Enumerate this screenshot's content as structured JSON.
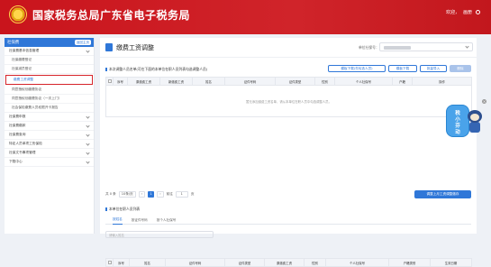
{
  "header": {
    "title": "国家税务总局广东省电子税务局",
    "welcome": "欢迎，",
    "user_name": "画册"
  },
  "sidebar": {
    "title": "社保费",
    "collapse_label": "返回主页",
    "items": [
      {
        "label": "社保费基本信息管理",
        "type": "group"
      },
      {
        "label": "社保缴费登记",
        "type": "sub"
      },
      {
        "label": "社保减员登记",
        "type": "sub"
      },
      {
        "label": "缴费工资调整",
        "type": "sub",
        "active": true
      },
      {
        "label": "同意授权划缴费协议",
        "type": "sub"
      },
      {
        "label": "同意授权划缴费协议（一次上门）",
        "type": "sub"
      },
      {
        "label": "社会保险缴费人员权限开卡报告",
        "type": "sub"
      },
      {
        "label": "社保费申报",
        "type": "group"
      },
      {
        "label": "社保费缴款",
        "type": "group"
      },
      {
        "label": "社保费查询",
        "type": "group"
      },
      {
        "label": "特定人员单项工伤保险",
        "type": "group"
      },
      {
        "label": "社保文书事项管理",
        "type": "group"
      },
      {
        "label": "下载中心",
        "type": "group"
      }
    ]
  },
  "page": {
    "title": "缴费工资调整",
    "unit_label": "单位社保号："
  },
  "section1": {
    "title": "本次调整人员名单(可在下面的本单位在职人员列表勾选调整人员)",
    "buttons": [
      "模板下载(先勾选人员)",
      "模板下载",
      "批量导入",
      "删除"
    ],
    "columns": [
      "",
      "序号",
      "原缴费工资",
      "新缴费工资",
      "姓名",
      "证件号码",
      "证件类型",
      "性别",
      "个人社保号",
      "户籍",
      "操作"
    ],
    "empty_text": "暂无添加缴费工资名单，请从本单位在职人员中勾选调整人员。"
  },
  "pagination": {
    "total": "共 0 条",
    "page_size": "10条/页",
    "current_page": "1",
    "goto_label": "前往",
    "goto_value": "1",
    "page_unit": "页"
  },
  "save_button": "调整上月工资调整缴存",
  "section2": {
    "title": "本单位在职人员列表",
    "tabs": [
      "按姓名",
      "按证件号码",
      "按个人社保号"
    ],
    "search_placeholder": "请输入姓名",
    "columns": [
      "",
      "序号",
      "姓名",
      "证件号码",
      "证件类型",
      "原缴费工资",
      "性别",
      "个人社保号",
      "户籍类别",
      "生效日期"
    ]
  },
  "widget": {
    "text": "税\n小\n芬\n动"
  }
}
